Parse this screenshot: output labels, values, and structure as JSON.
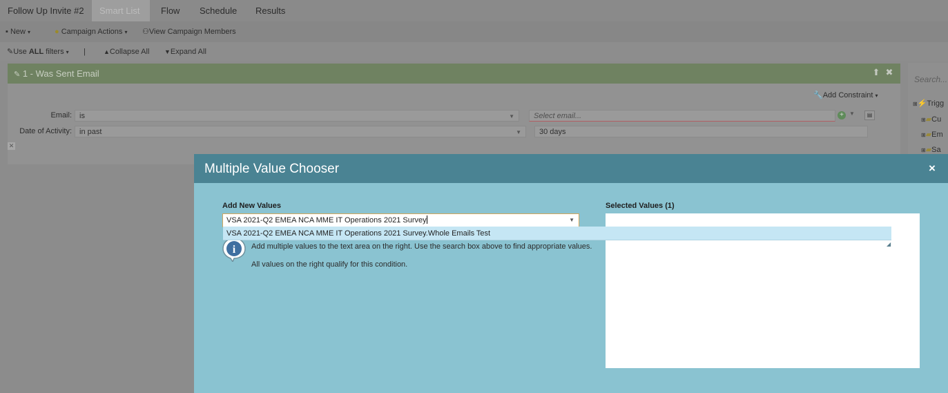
{
  "tabs": [
    {
      "label": "Follow Up Invite #2"
    },
    {
      "label": "Smart List"
    },
    {
      "label": "Flow"
    },
    {
      "label": "Schedule"
    },
    {
      "label": "Results"
    }
  ],
  "toolbar": {
    "new_label": "New",
    "campaign_actions_label": "Campaign Actions",
    "view_members_label": "View Campaign Members"
  },
  "filterbar": {
    "use_prefix": "Use",
    "use_all": "ALL",
    "use_suffix": "filters",
    "separator": "|",
    "collapse_all": "Collapse All",
    "expand_all": "Expand All"
  },
  "filter": {
    "title": "1 - Was Sent Email",
    "add_constraint": "Add Constraint",
    "email_label": "Email:",
    "email_operator": "is",
    "email_placeholder": "Select email...",
    "date_label": "Date of Activity:",
    "date_operator": "in past",
    "date_value": "30 days"
  },
  "right_panel": {
    "search_placeholder": "Search...",
    "items": [
      "Trigg",
      "Cu",
      "Em",
      "Sa"
    ]
  },
  "modal": {
    "title": "Multiple Value Chooser",
    "close": "×",
    "add_new_label": "Add New Values",
    "search_value": "VSA 2021-Q2 EMEA NCA MME IT Operations 2021 Survey",
    "suggestion": "VSA 2021-Q2 EMEA NCA MME IT Operations 2021 Survey.Whole Emails Test",
    "help_line1": "Add multiple values to the text area on the right. Use the search box above to find appropriate values.",
    "help_line2": "All values on the right qualify for this condition.",
    "selected_label": "Selected Values (1)"
  },
  "colors": {
    "modal_header": "#4a8393",
    "modal_body": "#8ac3d1",
    "filter_header": "#6f8261",
    "suggestion_bg": "#c5e6f4"
  }
}
